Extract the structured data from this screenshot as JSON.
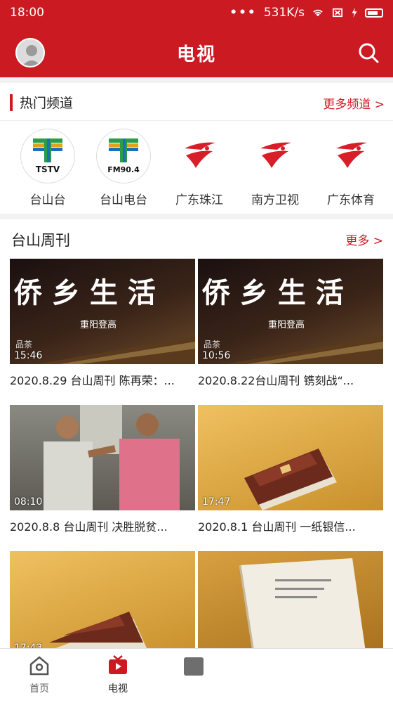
{
  "status": {
    "time": "18:00",
    "speed": "531K/s"
  },
  "header": {
    "title": "电视"
  },
  "hot": {
    "title": "热门频道",
    "more": "更多频道 >",
    "channels": [
      {
        "name": "台山台",
        "logo_text": "TSTV"
      },
      {
        "name": "台山电台",
        "logo_text": "FM90.4"
      },
      {
        "name": "广东珠江"
      },
      {
        "name": "南方卫视"
      },
      {
        "name": "广东体育"
      }
    ]
  },
  "weekly": {
    "title": "台山周刊",
    "more": "更多 >",
    "videos": [
      {
        "title": "2020.8.29 台山周刊 陈再荣：...",
        "duration": "15:46",
        "overlay": "侨 乡 生 活",
        "sub": "重阳登高",
        "corner": "品茶"
      },
      {
        "title": "2020.8.22台山周刊 镌刻战“...",
        "duration": "10:56",
        "overlay": "侨 乡 生 活",
        "sub": "重阳登高",
        "corner": "品茶"
      },
      {
        "title": "2020.8.8 台山周刊 决胜脱贫...",
        "duration": "08:10"
      },
      {
        "title": "2020.8.1 台山周刊 一纸银信...",
        "duration": "17:47"
      },
      {
        "title": "",
        "duration": "17:43"
      },
      {
        "title": "",
        "duration": ""
      }
    ]
  },
  "nav": {
    "items": [
      {
        "label": "首页"
      },
      {
        "label": "电视"
      }
    ]
  },
  "colors": {
    "brand_red": "#cc1a22"
  }
}
